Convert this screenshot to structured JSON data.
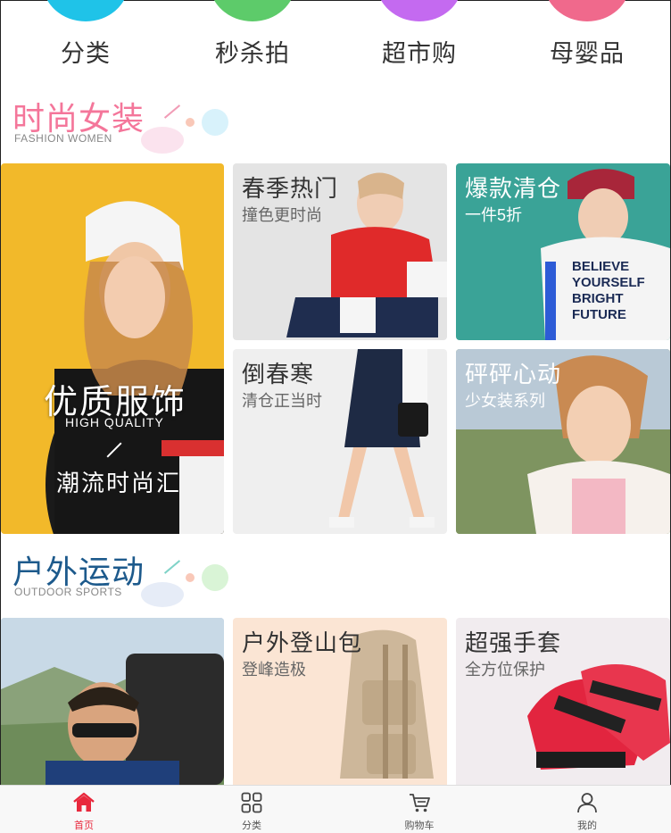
{
  "categories": [
    {
      "label": "分类",
      "color": "#1fc3e8"
    },
    {
      "label": "秒杀拍",
      "color": "#5dcb6a"
    },
    {
      "label": "超市购",
      "color": "#c46af0"
    },
    {
      "label": "母婴品",
      "color": "#f0698c"
    }
  ],
  "section_fashion": {
    "title": "时尚女装",
    "subtitle": "FASHION WOMEN",
    "title_color": "#f4769a"
  },
  "fashion_tiles": {
    "big": {
      "title": "优质服饰",
      "en": "HIGH QUALITY",
      "sub": "潮流时尚汇"
    },
    "t1": {
      "title": "春季热门",
      "sub": "撞色更时尚"
    },
    "t2": {
      "title": "爆款清仓",
      "sub": "一件5折"
    },
    "t3": {
      "title": "倒春寒",
      "sub": "清仓正当时"
    },
    "t4": {
      "title": "砰砰心动",
      "sub": "少女装系列"
    }
  },
  "section_outdoor": {
    "title": "户外运动",
    "subtitle": "OUTDOOR SPORTS",
    "title_color": "#1d5a8c"
  },
  "outdoor_tiles": {
    "t1": {
      "title": "户外登山包",
      "sub": "登峰造极"
    },
    "t2": {
      "title": "超强手套",
      "sub": "全方位保护"
    }
  },
  "tabbar": {
    "active_color": "#e8283c",
    "items": [
      {
        "label": "首页",
        "icon": "home-icon",
        "active": true
      },
      {
        "label": "分类",
        "icon": "grid-icon",
        "active": false
      },
      {
        "label": "购物车",
        "icon": "cart-icon",
        "active": false
      },
      {
        "label": "我的",
        "icon": "user-icon",
        "active": false
      }
    ]
  }
}
